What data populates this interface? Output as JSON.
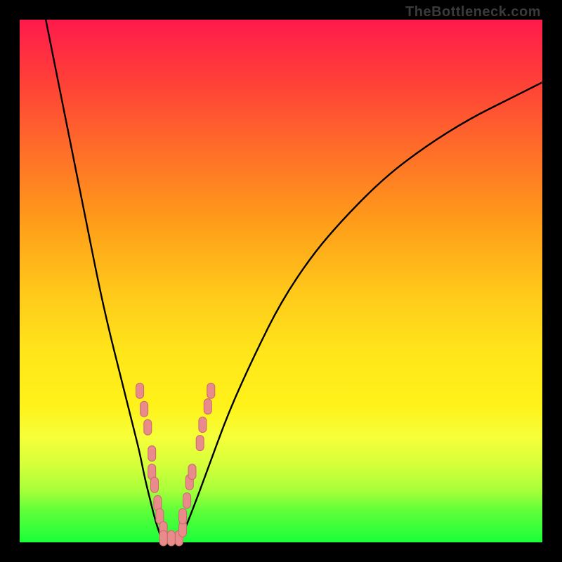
{
  "watermark": "TheBottleneck.com",
  "colors": {
    "curve": "#000000",
    "marker_fill": "#e98b8b",
    "marker_stroke": "#c96a6a",
    "gradient_top": "#ff1a4d",
    "gradient_bottom": "#1aff3a"
  },
  "chart_data": {
    "type": "line",
    "title": "",
    "xlabel": "",
    "ylabel": "",
    "xlim": [
      0,
      100
    ],
    "ylim": [
      0,
      100
    ],
    "note": "Axes are unlabeled in the source image; x and y expressed as 0-100% of the plot area. y=0 is bottom (green), y=100 is top (red).",
    "series": [
      {
        "name": "left-branch",
        "x": [
          5,
          7,
          9,
          11,
          13,
          15,
          17,
          19,
          20,
          21,
          22,
          23,
          24,
          25,
          26,
          27
        ],
        "y": [
          100,
          90,
          80,
          70,
          60,
          50,
          41,
          33,
          29,
          25,
          21,
          17,
          12,
          8,
          4,
          1
        ]
      },
      {
        "name": "valley-floor",
        "x": [
          27,
          28,
          29,
          30,
          31
        ],
        "y": [
          1,
          0.5,
          0.5,
          0.5,
          1
        ]
      },
      {
        "name": "right-branch",
        "x": [
          31,
          33,
          36,
          40,
          45,
          50,
          56,
          62,
          70,
          78,
          86,
          94,
          100
        ],
        "y": [
          1,
          6,
          14,
          25,
          36,
          46,
          55,
          62,
          70,
          76,
          81,
          85,
          88
        ]
      }
    ],
    "markers": [
      {
        "x": 23.0,
        "y": 29.0
      },
      {
        "x": 23.8,
        "y": 25.5
      },
      {
        "x": 24.5,
        "y": 22.0
      },
      {
        "x": 25.3,
        "y": 17.0
      },
      {
        "x": 25.3,
        "y": 13.5
      },
      {
        "x": 25.8,
        "y": 11.0
      },
      {
        "x": 26.4,
        "y": 7.5
      },
      {
        "x": 26.8,
        "y": 5.0
      },
      {
        "x": 27.5,
        "y": 2.5
      },
      {
        "x": 27.5,
        "y": 0.8
      },
      {
        "x": 29.0,
        "y": 0.8
      },
      {
        "x": 30.5,
        "y": 0.8
      },
      {
        "x": 31.2,
        "y": 2.5
      },
      {
        "x": 31.2,
        "y": 5.0
      },
      {
        "x": 32.0,
        "y": 8.0
      },
      {
        "x": 32.5,
        "y": 11.5
      },
      {
        "x": 33.0,
        "y": 13.5
      },
      {
        "x": 34.5,
        "y": 19.0
      },
      {
        "x": 35.0,
        "y": 22.5
      },
      {
        "x": 36.0,
        "y": 26.0
      },
      {
        "x": 36.6,
        "y": 29.0
      }
    ],
    "marker_shape": "rounded-rect",
    "marker_size_px": {
      "w": 11,
      "h": 22
    }
  }
}
